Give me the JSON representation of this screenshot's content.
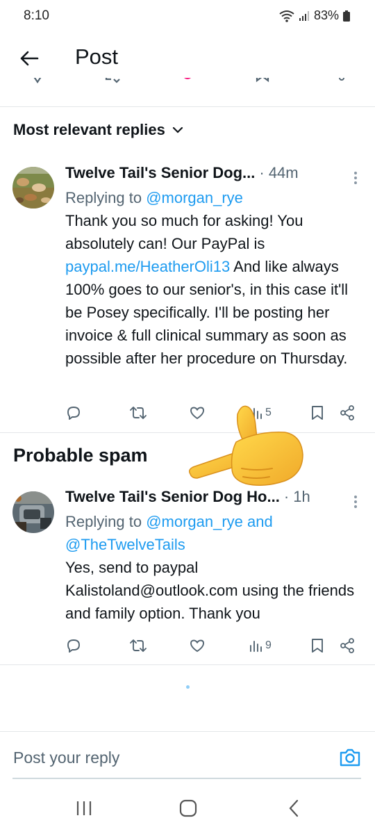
{
  "status_bar": {
    "time": "8:10",
    "battery": "83%",
    "icons": [
      "wifi-icon",
      "signal-icon",
      "battery-icon"
    ]
  },
  "header": {
    "title": "Post",
    "back_icon": "arrow-left-icon"
  },
  "sort": {
    "label": "Most relevant replies",
    "icon": "chevron-down-icon"
  },
  "replies": [
    {
      "name": "Twelve Tail's Senior Dog...",
      "time": "· 44m",
      "replying_prefix": "Replying to ",
      "replying_to": "@morgan_rye",
      "text_before_link": "Thank you so much for asking! You absolutely can! Our PayPal is ",
      "link": "paypal.me/HeatherOli13",
      "text_after_link": " And like always 100% goes to our senior's, in this case it'll be Posey specifically. I'll be posting her invoice & full clinical summary as soon as possible after her procedure on Thursday.",
      "views": "5"
    },
    {
      "name": "Twelve Tail's Senior Dog Ho...",
      "time": "· 1h",
      "replying_prefix": "Replying to ",
      "replying_to": "@morgan_rye and @TheTwelveTails",
      "text": "Yes, send to paypal Kalistoland@outlook.com using the friends and family option. Thank you",
      "views": "9"
    }
  ],
  "spam_section": {
    "title": "Probable spam"
  },
  "composer": {
    "placeholder": "Post your reply",
    "icon": "camera-icon"
  },
  "colors": {
    "accent": "#1d9bf0",
    "text": "#0f1419",
    "muted": "#536471",
    "like_pink": "#f91880",
    "emoji_yellow": "#f7c531"
  },
  "nav": {
    "icons": [
      "recent-apps-icon",
      "home-icon",
      "back-icon"
    ]
  }
}
